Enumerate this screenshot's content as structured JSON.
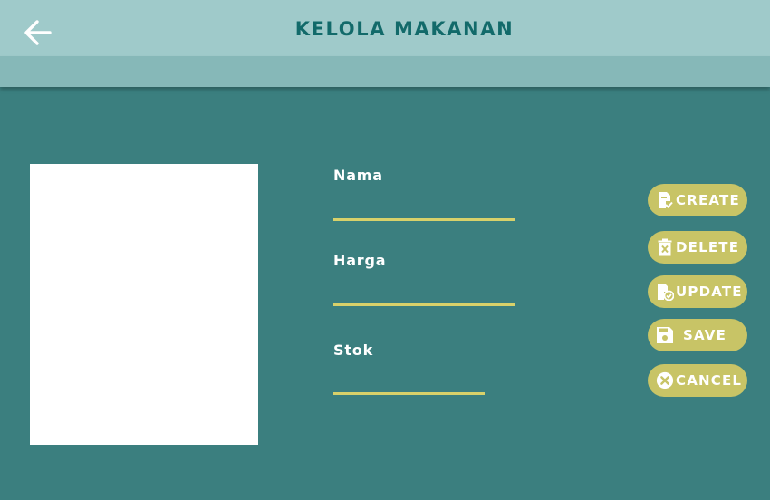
{
  "header": {
    "title": "KELOLA MAKANAN",
    "back_icon": "arrow-left-icon"
  },
  "form": {
    "fields": [
      {
        "label": "Nama",
        "value": "",
        "placeholder": ""
      },
      {
        "label": "Harga",
        "value": "",
        "placeholder": ""
      },
      {
        "label": "Stok",
        "value": "",
        "placeholder": ""
      }
    ]
  },
  "actions": [
    {
      "label": "CREATE",
      "icon": "document-check-icon"
    },
    {
      "label": "DELETE",
      "icon": "trash-icon"
    },
    {
      "label": "UPDATE",
      "icon": "document-update-icon"
    },
    {
      "label": "SAVE",
      "icon": "floppy-disk-icon"
    },
    {
      "label": "CANCEL",
      "icon": "close-circle-icon"
    }
  ],
  "colors": {
    "background": "#3b7f7f",
    "header": "#9fcaca",
    "accent": "#c8c466",
    "title": "#126a6a"
  }
}
